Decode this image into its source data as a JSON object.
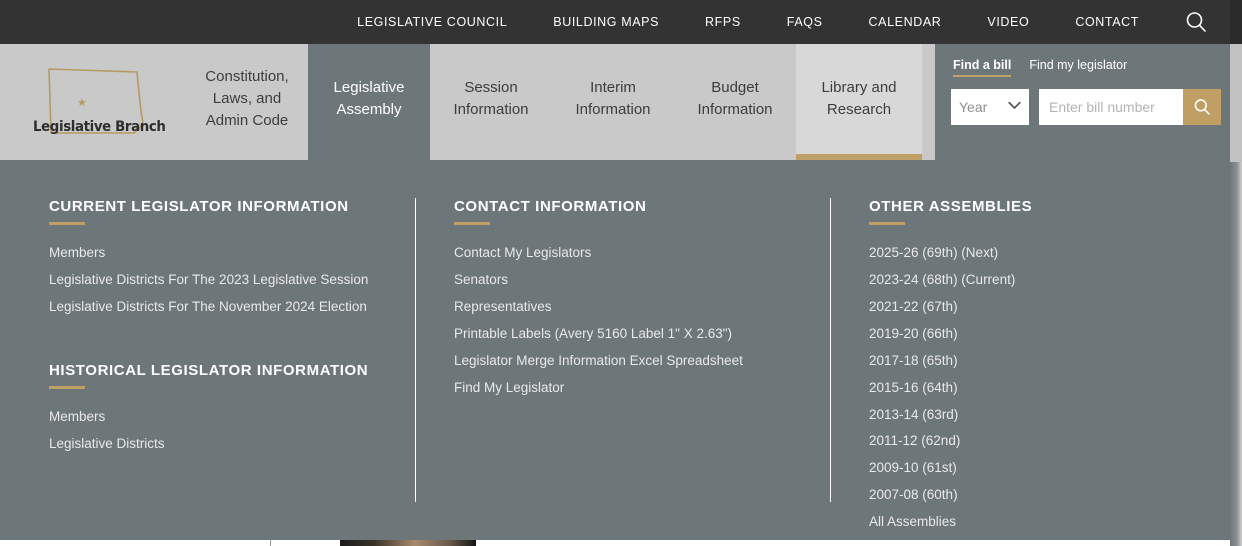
{
  "topbar": {
    "links": [
      "LEGISLATIVE COUNCIL",
      "BUILDING MAPS",
      "RFPS",
      "FAQS",
      "CALENDAR",
      "VIDEO",
      "CONTACT"
    ],
    "search_icon": "search-icon"
  },
  "logo": {
    "text": "Legislative Branch",
    "outline": "north-dakota-state-outline",
    "star": "★",
    "outline_color": "#b59a63"
  },
  "nav": {
    "tabs": [
      {
        "label": "Constitution, Laws, and Admin Code",
        "state": "default"
      },
      {
        "label": "Legislative Assembly",
        "state": "open"
      },
      {
        "label": "Session Information",
        "state": "default"
      },
      {
        "label": "Interim Information",
        "state": "default"
      },
      {
        "label": "Budget Information",
        "state": "default"
      },
      {
        "label": "Library and Research",
        "state": "current"
      }
    ]
  },
  "search": {
    "tab_bill": "Find a bill",
    "tab_legislator": "Find my legislator",
    "active_tab": "Find a bill",
    "year_value": "Year",
    "chevron": "⌄",
    "bill_placeholder": "Enter bill number",
    "bill_value": "",
    "submit_icon": "search-icon"
  },
  "megamenu": {
    "columns": [
      {
        "groups": [
          {
            "heading": "CURRENT LEGISLATOR INFORMATION",
            "items": [
              "Members",
              "Legislative Districts For The 2023 Legislative Session",
              "Legislative Districts For The November 2024 Election"
            ]
          },
          {
            "heading": "HISTORICAL LEGISLATOR INFORMATION",
            "items": [
              "Members",
              "Legislative Districts"
            ]
          }
        ]
      },
      {
        "groups": [
          {
            "heading": "CONTACT INFORMATION",
            "items": [
              "Contact My Legislators",
              "Senators",
              "Representatives",
              "Printable Labels (Avery 5160 Label 1\" X 2.63\")",
              "Legislator Merge Information Excel Spreadsheet",
              "Find My Legislator"
            ]
          }
        ]
      },
      {
        "groups": [
          {
            "heading": "OTHER ASSEMBLIES",
            "items": [
              "2025-26 (69th) (Next)",
              "2023-24 (68th) (Current)",
              "2021-22 (67th)",
              "2019-20 (66th)",
              "2017-18 (65th)",
              "2015-16 (64th)",
              "2013-14 (63rd)",
              "2011-12 (62nd)",
              "2009-10 (61st)",
              "2007-08 (60th)",
              "All Assemblies"
            ]
          }
        ]
      }
    ]
  },
  "colors": {
    "topbar_bg": "#333333",
    "header_bg": "#c9c9c9",
    "panel_bg": "#6d7679",
    "accent_gold": "#bf9f63",
    "current_tab_bg": "#d8d8d8"
  }
}
